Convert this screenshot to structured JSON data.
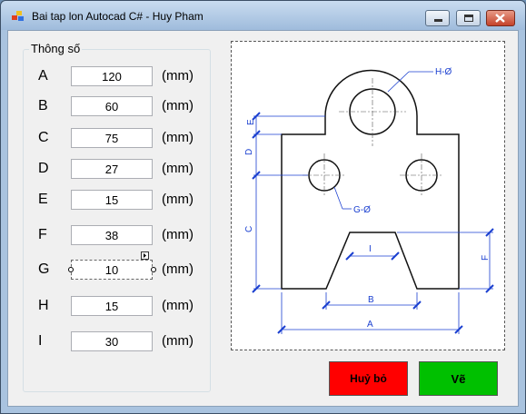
{
  "window": {
    "title": "Bai tap lon Autocad C# - Huy Pham"
  },
  "group": {
    "title": "Thông số"
  },
  "params": [
    {
      "label": "A",
      "value": "120",
      "unit": "(mm)"
    },
    {
      "label": "B",
      "value": "60",
      "unit": "(mm)"
    },
    {
      "label": "C",
      "value": "75",
      "unit": "(mm)"
    },
    {
      "label": "D",
      "value": "27",
      "unit": "(mm)"
    },
    {
      "label": "E",
      "value": "15",
      "unit": "(mm)"
    },
    {
      "label": "F",
      "value": "38",
      "unit": "(mm)"
    },
    {
      "label": "G",
      "value": "10",
      "unit": "(mm)"
    },
    {
      "label": "H",
      "value": "15",
      "unit": "(mm)"
    },
    {
      "label": "I",
      "value": "30",
      "unit": "(mm)"
    }
  ],
  "drawing": {
    "labels": {
      "h": "H-Ø",
      "g": "G-Ø",
      "e": "E",
      "d": "D",
      "c": "C",
      "f": "F",
      "i": "I",
      "b": "B",
      "a": "A"
    }
  },
  "buttons": {
    "cancel": "Huỷ bỏ",
    "draw": "Vẽ"
  },
  "colors": {
    "cancel": "#ff0000",
    "draw": "#00c000",
    "dimension": "#1a3fd0"
  }
}
